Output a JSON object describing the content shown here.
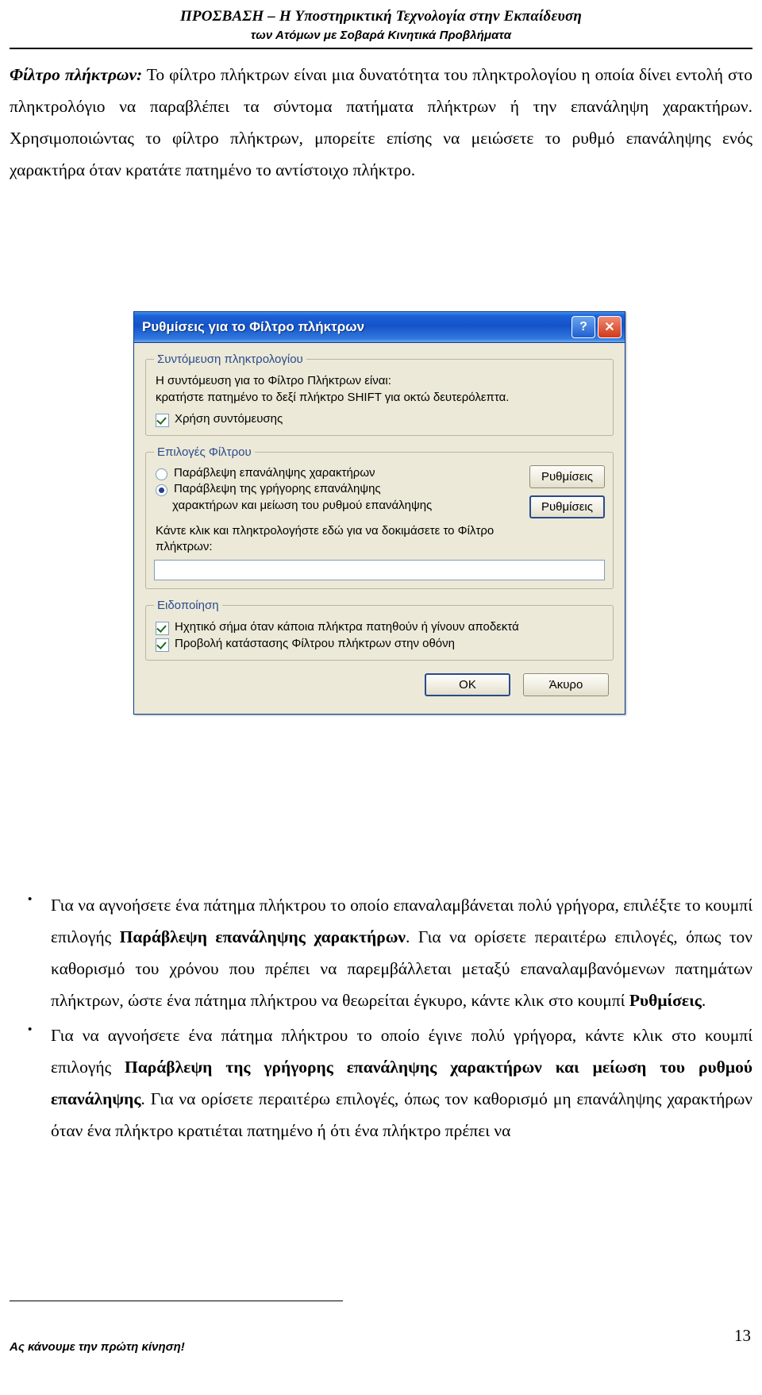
{
  "header": {
    "line1": "ΠΡΟΣΒΑΣΗ – Η Υποστηρικτική Τεχνολογία στην Εκπαίδευση",
    "line2": "των Ατόμων με Σοβαρά Κινητικά Προβλήματα"
  },
  "body": {
    "para1_lead": "Φίλτρο πλήκτρων:",
    "para1_rest": " Το φίλτρο πλήκτρων είναι μια δυνατότητα του πληκτρολογίου η οποία δίνει εντολή στο πληκτρολόγιο να παραβλέπει τα σύντομα πατήματα πλήκτρων ή την επανάληψη χαρακτήρων. Χρησιμοποιώντας το φίλτρο πλήκτρων, μπορείτε επίσης να μειώσετε το ρυθμό επανάληψης ενός χαρακτήρα όταν κρατάτε πατημένο το αντίστοιχο πλήκτρο.",
    "bullet1_part1": "Για να αγνοήσετε ένα πάτημα πλήκτρου το οποίο επαναλαμβάνεται πολύ γρήγορα, επιλέξτε το κουμπί επιλογής ",
    "bullet1_bold1": "Παράβλεψη επανάληψης χαρακτήρων",
    "bullet1_part2": ". Για να ορίσετε περαιτέρω επιλογές, όπως τον καθορισμό του χρόνου που πρέπει να παρεμβάλλεται μεταξύ επαναλαμβανόμενων πατημάτων πλήκτρων, ώστε ένα πάτημα πλήκτρου να θεωρείται έγκυρο, κάντε κλικ στο κουμπί ",
    "bullet1_bold2": "Ρυθμίσεις",
    "bullet1_part3": ".",
    "bullet2_part1": "Για να αγνοήσετε ένα πάτημα πλήκτρου το οποίο έγινε πολύ γρήγορα, κάντε κλικ στο κουμπί επιλογής ",
    "bullet2_bold1": "Παράβλεψη της γρήγορης επανάληψης χαρακτήρων και μείωση του ρυθμού επανάληψης",
    "bullet2_part2": ". Για να ορίσετε περαιτέρω επιλογές, όπως τον καθορισμό μη επανάληψης χαρακτήρων όταν ένα πλήκτρο κρατιέται πατημένο ή ότι ένα πλήκτρο πρέπει να"
  },
  "dialog": {
    "title": "Ρυθμίσεις για το Φίλτρο πλήκτρων",
    "help_button": "?",
    "close_button": "✕",
    "group_shortcut": {
      "legend": "Συντόμευση πληκτρολογίου",
      "text_line1": "Η συντόμευση για το Φίλτρο Πλήκτρων είναι:",
      "text_line2": "κρατήστε πατημένο το δεξί πλήκτρο SHIFT για οκτώ δευτερόλεπτα.",
      "checkbox_label": "Χρήση συντόμευσης",
      "checkbox_checked": true
    },
    "group_options": {
      "legend": "Επιλογές Φίλτρου",
      "radio1_label": "Παράβλεψη επανάληψης χαρακτήρων",
      "radio1_selected": false,
      "radio2_label": "Παράβλεψη της γρήγορης επανάληψης",
      "radio2_sub": "χαρακτήρων και μείωση του ρυθμού επανάληψης",
      "radio2_selected": true,
      "settings_button_1": "Ρυθμίσεις",
      "settings_button_2": "Ρυθμίσεις",
      "test_label_line1": "Κάντε κλικ και πληκτρολογήστε εδώ για να δοκιμάσετε το Φίλτρο",
      "test_label_line2": "πλήκτρων:",
      "test_input_value": ""
    },
    "group_notify": {
      "legend": "Ειδοποίηση",
      "checkbox1_label": "Ηχητικό σήμα όταν κάποια πλήκτρα πατηθούν ή γίνουν αποδεκτά",
      "checkbox1_checked": true,
      "checkbox2_label": "Προβολή κατάστασης Φίλτρου πλήκτρων στην οθόνη",
      "checkbox2_checked": true
    },
    "ok_button": "OK",
    "cancel_button": "Άκυρο"
  },
  "footer": {
    "note": "Ας κάνουμε την πρώτη κίνηση!",
    "page_number": "13"
  }
}
